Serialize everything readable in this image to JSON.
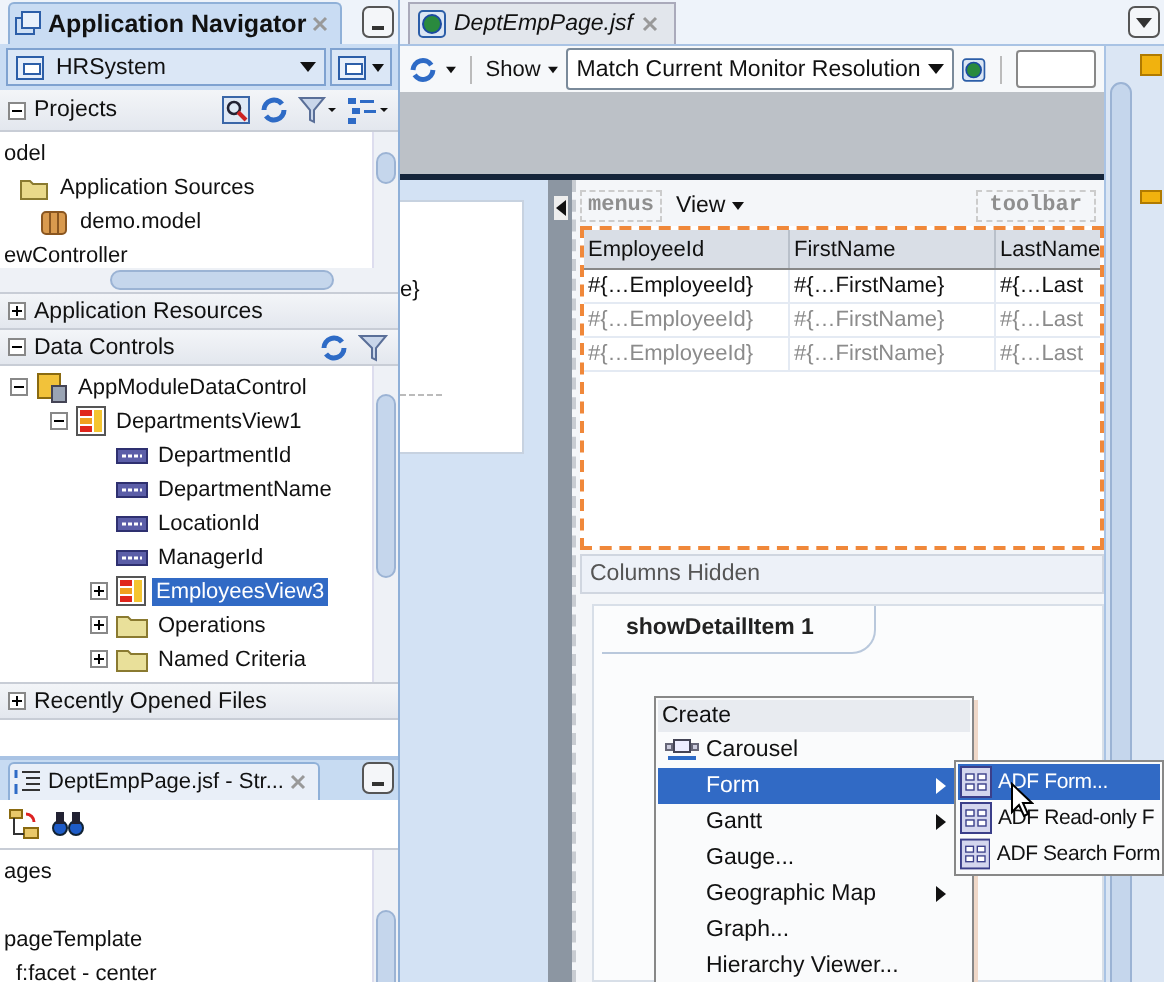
{
  "navigator": {
    "title": "Application Navigator",
    "application": "HRSystem"
  },
  "projects": {
    "title": "Projects",
    "expanded": true,
    "tree": [
      {
        "label": "odel",
        "children": [
          {
            "label": "Application Sources",
            "kind": "folder",
            "children": [
              {
                "label": "demo.model",
                "kind": "package"
              }
            ]
          }
        ]
      },
      {
        "label": "ewController"
      }
    ]
  },
  "application_resources": {
    "title": "Application Resources",
    "expanded": false
  },
  "data_controls": {
    "title": "Data Controls",
    "expanded": true,
    "tree": [
      {
        "label": "AppModuleDataControl",
        "kind": "datacontrol",
        "expanded": true,
        "selected": false,
        "children": [
          {
            "label": "DepartmentsView1",
            "kind": "collection",
            "expanded": true,
            "selected": false,
            "children": [
              {
                "label": "DepartmentId",
                "kind": "attribute",
                "selected": false
              },
              {
                "label": "DepartmentName",
                "kind": "attribute",
                "selected": false
              },
              {
                "label": "LocationId",
                "kind": "attribute",
                "selected": false
              },
              {
                "label": "ManagerId",
                "kind": "attribute",
                "selected": false
              },
              {
                "label": "EmployeesView3",
                "kind": "collection",
                "expanded": false,
                "selected": true
              },
              {
                "label": "Operations",
                "kind": "folder",
                "expanded": false,
                "selected": false
              },
              {
                "label": "Named Criteria",
                "kind": "folder",
                "expanded": false,
                "selected": false
              }
            ]
          }
        ]
      }
    ]
  },
  "recently_opened": {
    "title": "Recently Opened Files",
    "expanded": false
  },
  "structure": {
    "title": "DeptEmpPage.jsf - Str...",
    "tree": [
      {
        "label": "ages"
      },
      {
        "label": "pageTemplate",
        "children": [
          {
            "label": "f:facet - center"
          }
        ]
      }
    ]
  },
  "editor": {
    "tab": "DeptEmpPage.jsf",
    "show": "Show",
    "resolution": "Match Current Monitor Resolution",
    "remnant": "e}",
    "page": {
      "menus": "menus",
      "menu": "View",
      "toolbar": "toolbar",
      "table": {
        "columns": [
          "EmployeeId",
          "FirstName",
          "LastName"
        ],
        "rows": [
          {
            "dimmed": false,
            "cells": [
              "#{…EmployeeId}",
              "#{…FirstName}",
              "#{…Last"
            ]
          },
          {
            "dimmed": true,
            "cells": [
              "#{…EmployeeId}",
              "#{…FirstName}",
              "#{…Last"
            ]
          },
          {
            "dimmed": true,
            "cells": [
              "#{…EmployeeId}",
              "#{…FirstName}",
              "#{…Last"
            ]
          }
        ]
      },
      "columns_hidden": "Columns Hidden",
      "detail_tab": "showDetailItem 1"
    }
  },
  "context_menu": {
    "title": "Create",
    "items": [
      {
        "label": "Carousel",
        "kind": "icon",
        "submenu": false,
        "selected": false
      },
      {
        "label": "Form",
        "kind": "plain",
        "submenu": true,
        "selected": true
      },
      {
        "label": "Gantt",
        "kind": "plain",
        "submenu": true,
        "selected": false
      },
      {
        "label": "Gauge...",
        "kind": "plain",
        "submenu": false,
        "selected": false
      },
      {
        "label": "Geographic Map",
        "kind": "plain",
        "submenu": true,
        "selected": false
      },
      {
        "label": "Graph...",
        "kind": "plain",
        "submenu": false,
        "selected": false
      },
      {
        "label": "Hierarchy Viewer...",
        "kind": "plain",
        "submenu": false,
        "selected": false
      }
    ]
  },
  "submenu": {
    "items": [
      {
        "label": "ADF Form...",
        "selected": true
      },
      {
        "label": "ADF Read-only F",
        "selected": false
      },
      {
        "label": "ADF Search Form",
        "selected": false
      }
    ]
  }
}
